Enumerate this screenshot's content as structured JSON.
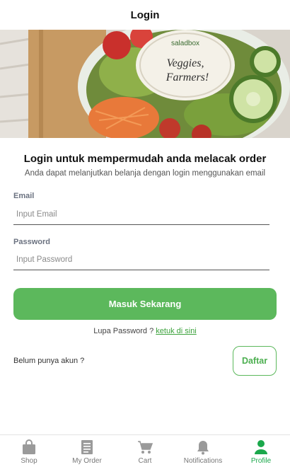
{
  "header": {
    "title": "Login"
  },
  "hero": {
    "jar_lid_brand": "saladbox",
    "jar_lid_text": [
      "Veggies,",
      "Farmers!"
    ]
  },
  "intro": {
    "title": "Login untuk mempermudah anda melacak order",
    "subtitle": "Anda dapat melanjutkan belanja dengan login menggunakan email"
  },
  "form": {
    "email": {
      "label": "Email",
      "placeholder": "Input Email",
      "value": ""
    },
    "password": {
      "label": "Password",
      "placeholder": "Input Password",
      "value": ""
    },
    "submit_label": "Masuk Sekarang",
    "forgot_text": "Lupa Password ?",
    "forgot_link": "ketuk di sini"
  },
  "register": {
    "text": "Belum punya akun ?",
    "button_label": "Daftar"
  },
  "colors": {
    "primary": "#5cb85c",
    "active_nav": "#1aa84b",
    "inactive_nav": "#9a9a9a"
  },
  "nav": {
    "items": [
      {
        "label": "Shop",
        "icon": "shopping-bag-icon",
        "active": false
      },
      {
        "label": "My Order",
        "icon": "receipt-icon",
        "active": false
      },
      {
        "label": "Cart",
        "icon": "cart-icon",
        "active": false
      },
      {
        "label": "Notifications",
        "icon": "bell-icon",
        "active": false
      },
      {
        "label": "Profile",
        "icon": "person-icon",
        "active": true
      }
    ]
  }
}
